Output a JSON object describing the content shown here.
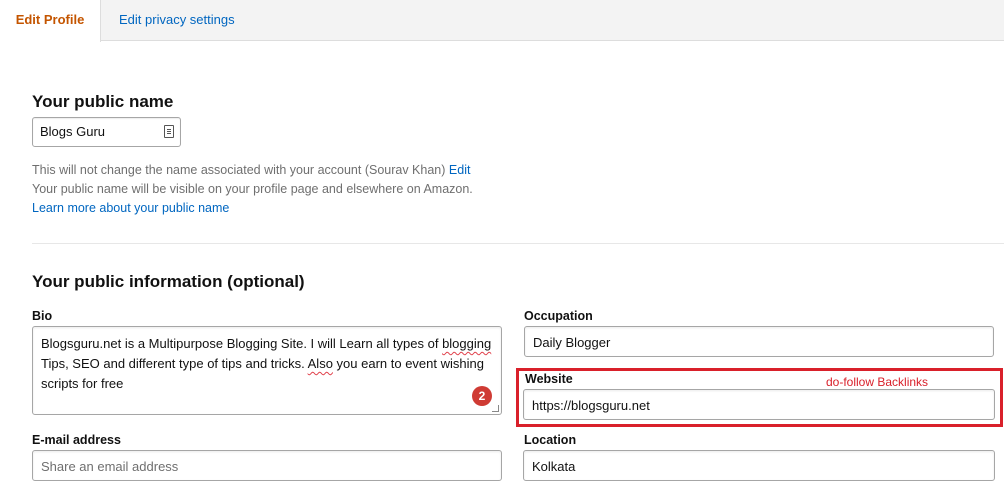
{
  "tabs": {
    "edit_profile": "Edit Profile",
    "privacy_settings": "Edit privacy settings"
  },
  "public_name": {
    "heading": "Your public name",
    "value": "Blogs Guru",
    "note_line1": "This will not change the name associated with your account (Sourav Khan)",
    "edit_link": "Edit",
    "note_line2": "Your public name will be visible on your profile page and elsewhere on Amazon.",
    "learn_more": "Learn more about your public name"
  },
  "public_info": {
    "heading": "Your public information (optional)",
    "bio": {
      "label": "Bio",
      "text_1": "Blogsguru.net is a Multipurpose Blogging Site. I will Learn all types of ",
      "text_2": "blogging",
      "text_3": " Tips, SEO and different type of tips and tricks. ",
      "text_4": "Also",
      "text_5": " you earn to event wishing scripts for free",
      "badge": "2"
    },
    "occupation": {
      "label": "Occupation",
      "value": "Daily Blogger"
    },
    "website": {
      "label": "Website",
      "value": "https://blogsguru.net",
      "annotation": "do-follow Backlinks"
    },
    "email": {
      "label": "E-mail address",
      "placeholder": "Share an email address"
    },
    "location": {
      "label": "Location",
      "value": "Kolkata"
    }
  },
  "colors": {
    "accent_orange": "#c45500",
    "link_blue": "#0066c0",
    "annotation_red": "#d9202a"
  }
}
